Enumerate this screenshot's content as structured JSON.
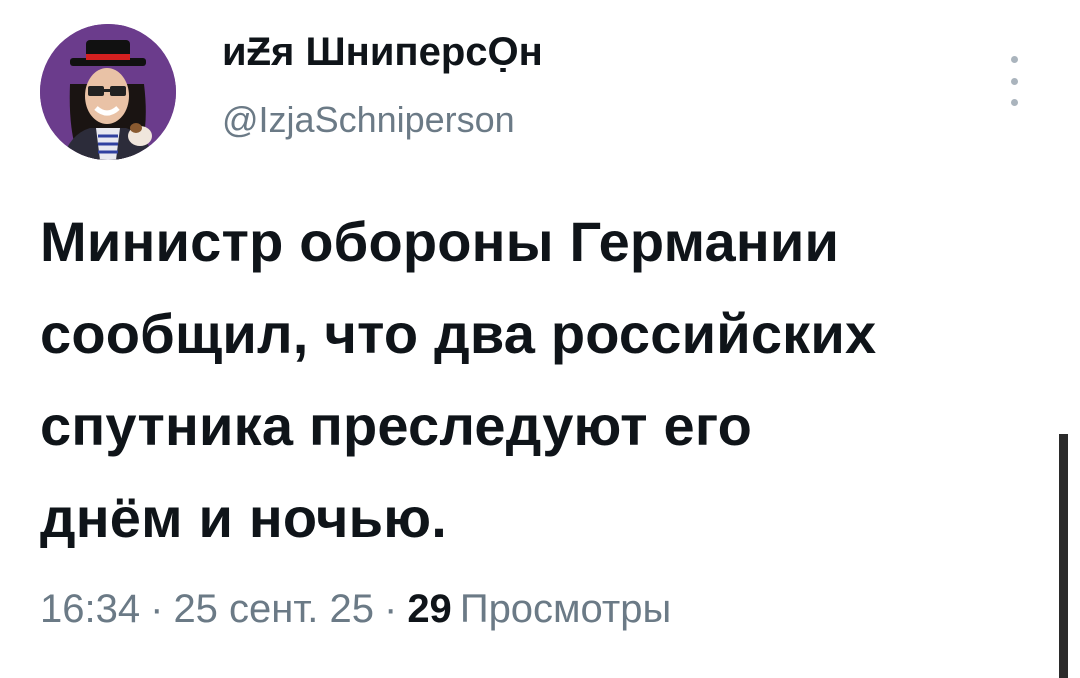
{
  "author": {
    "display_name": "иƵя ШниперсỌн",
    "handle": "@IzjaSchniperson"
  },
  "tweet": {
    "lines": [
      "Министр обороны Германии",
      "сообщил, что два российских",
      "спутника преследуют его",
      "днём и ночью."
    ]
  },
  "meta": {
    "time": "16:34",
    "date": "25 сент. 25",
    "separator": "·",
    "views_count": "29",
    "views_label": "Просмотры"
  },
  "icons": {
    "more": "more-vertical-icon"
  },
  "colors": {
    "text_primary": "#0f1419",
    "text_secondary": "#6b7a86",
    "background": "#ffffff"
  }
}
